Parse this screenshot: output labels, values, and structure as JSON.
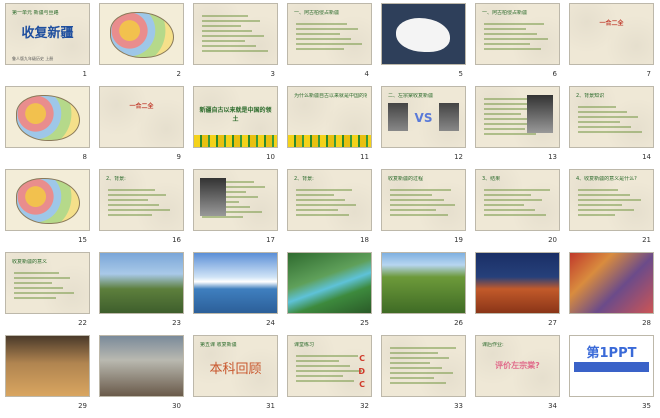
{
  "slides": [
    {
      "num": "1",
      "title": "第一单元 新疆与丝路",
      "main": "收复新疆",
      "sub": "鲁人版九年级历史 上册",
      "style": "plain"
    },
    {
      "num": "2",
      "title": "",
      "main": "",
      "sub": "",
      "style": "map"
    },
    {
      "num": "3",
      "title": "",
      "main": "",
      "sub": "",
      "style": "text"
    },
    {
      "num": "4",
      "title": "一、阿古柏侵占新疆",
      "main": "",
      "sub": "",
      "style": "text"
    },
    {
      "num": "5",
      "title": "",
      "main": "",
      "sub": "",
      "style": "dark"
    },
    {
      "num": "6",
      "title": "一、阿古柏侵占新疆",
      "main": "",
      "sub": "",
      "style": "text"
    },
    {
      "num": "7",
      "title": "",
      "main": "一合二全",
      "sub": "",
      "style": "text"
    },
    {
      "num": "8",
      "title": "",
      "main": "",
      "sub": "",
      "style": "map"
    },
    {
      "num": "9",
      "title": "",
      "main": "一合二全",
      "sub": "",
      "style": "text"
    },
    {
      "num": "10",
      "title": "",
      "main": "新疆自古以来就是中国的领土",
      "sub": "",
      "style": "flower"
    },
    {
      "num": "11",
      "title": "为什么新疆自古以来就是中国的领土?",
      "main": "",
      "sub": "",
      "style": "flower"
    },
    {
      "num": "12",
      "title": "二、左宗棠收复新疆",
      "main": "VS",
      "sub": "",
      "style": "text"
    },
    {
      "num": "13",
      "title": "",
      "main": "",
      "sub": "",
      "style": "text"
    },
    {
      "num": "14",
      "title": "2、背景知识",
      "main": "",
      "sub": "",
      "style": "text"
    },
    {
      "num": "15",
      "title": "",
      "main": "",
      "sub": "",
      "style": "map"
    },
    {
      "num": "16",
      "title": "2、背景:",
      "main": "",
      "sub": "",
      "style": "text"
    },
    {
      "num": "17",
      "title": "",
      "main": "",
      "sub": "",
      "style": "text"
    },
    {
      "num": "18",
      "title": "2、背景:",
      "main": "",
      "sub": "",
      "style": "text"
    },
    {
      "num": "19",
      "title": "收复新疆的过程",
      "main": "",
      "sub": "",
      "style": "text"
    },
    {
      "num": "20",
      "title": "3、结果",
      "main": "",
      "sub": "",
      "style": "text"
    },
    {
      "num": "21",
      "title": "4、收复新疆的意义是什么?",
      "main": "",
      "sub": "",
      "style": "text"
    },
    {
      "num": "22",
      "title": "收复新疆的意义",
      "main": "",
      "sub": "",
      "style": "text"
    },
    {
      "num": "23",
      "title": "",
      "main": "",
      "sub": "",
      "style": "nature"
    },
    {
      "num": "24",
      "title": "",
      "main": "",
      "sub": "",
      "style": "lake"
    },
    {
      "num": "25",
      "title": "",
      "main": "",
      "sub": "",
      "style": "river"
    },
    {
      "num": "26",
      "title": "",
      "main": "",
      "sub": "",
      "style": "valley"
    },
    {
      "num": "27",
      "title": "",
      "main": "",
      "sub": "",
      "style": "red"
    },
    {
      "num": "28",
      "title": "",
      "main": "",
      "sub": "",
      "style": "crowd"
    },
    {
      "num": "29",
      "title": "",
      "main": "",
      "sub": "",
      "style": "food"
    },
    {
      "num": "30",
      "title": "",
      "main": "",
      "sub": "",
      "style": "street"
    },
    {
      "num": "31",
      "title": "第五课 收复新疆",
      "main": "本科回顾",
      "sub": "",
      "style": "plain"
    },
    {
      "num": "32",
      "title": "课堂练习",
      "main": "",
      "sub": "",
      "style": "text"
    },
    {
      "num": "33",
      "title": "",
      "main": "",
      "sub": "",
      "style": "text"
    },
    {
      "num": "34",
      "title": "课后作业:",
      "main": "评价左宗棠?",
      "sub": "",
      "style": "plain"
    },
    {
      "num": "35",
      "title": "",
      "main": "第1PPT",
      "sub": "",
      "style": "white"
    }
  ]
}
